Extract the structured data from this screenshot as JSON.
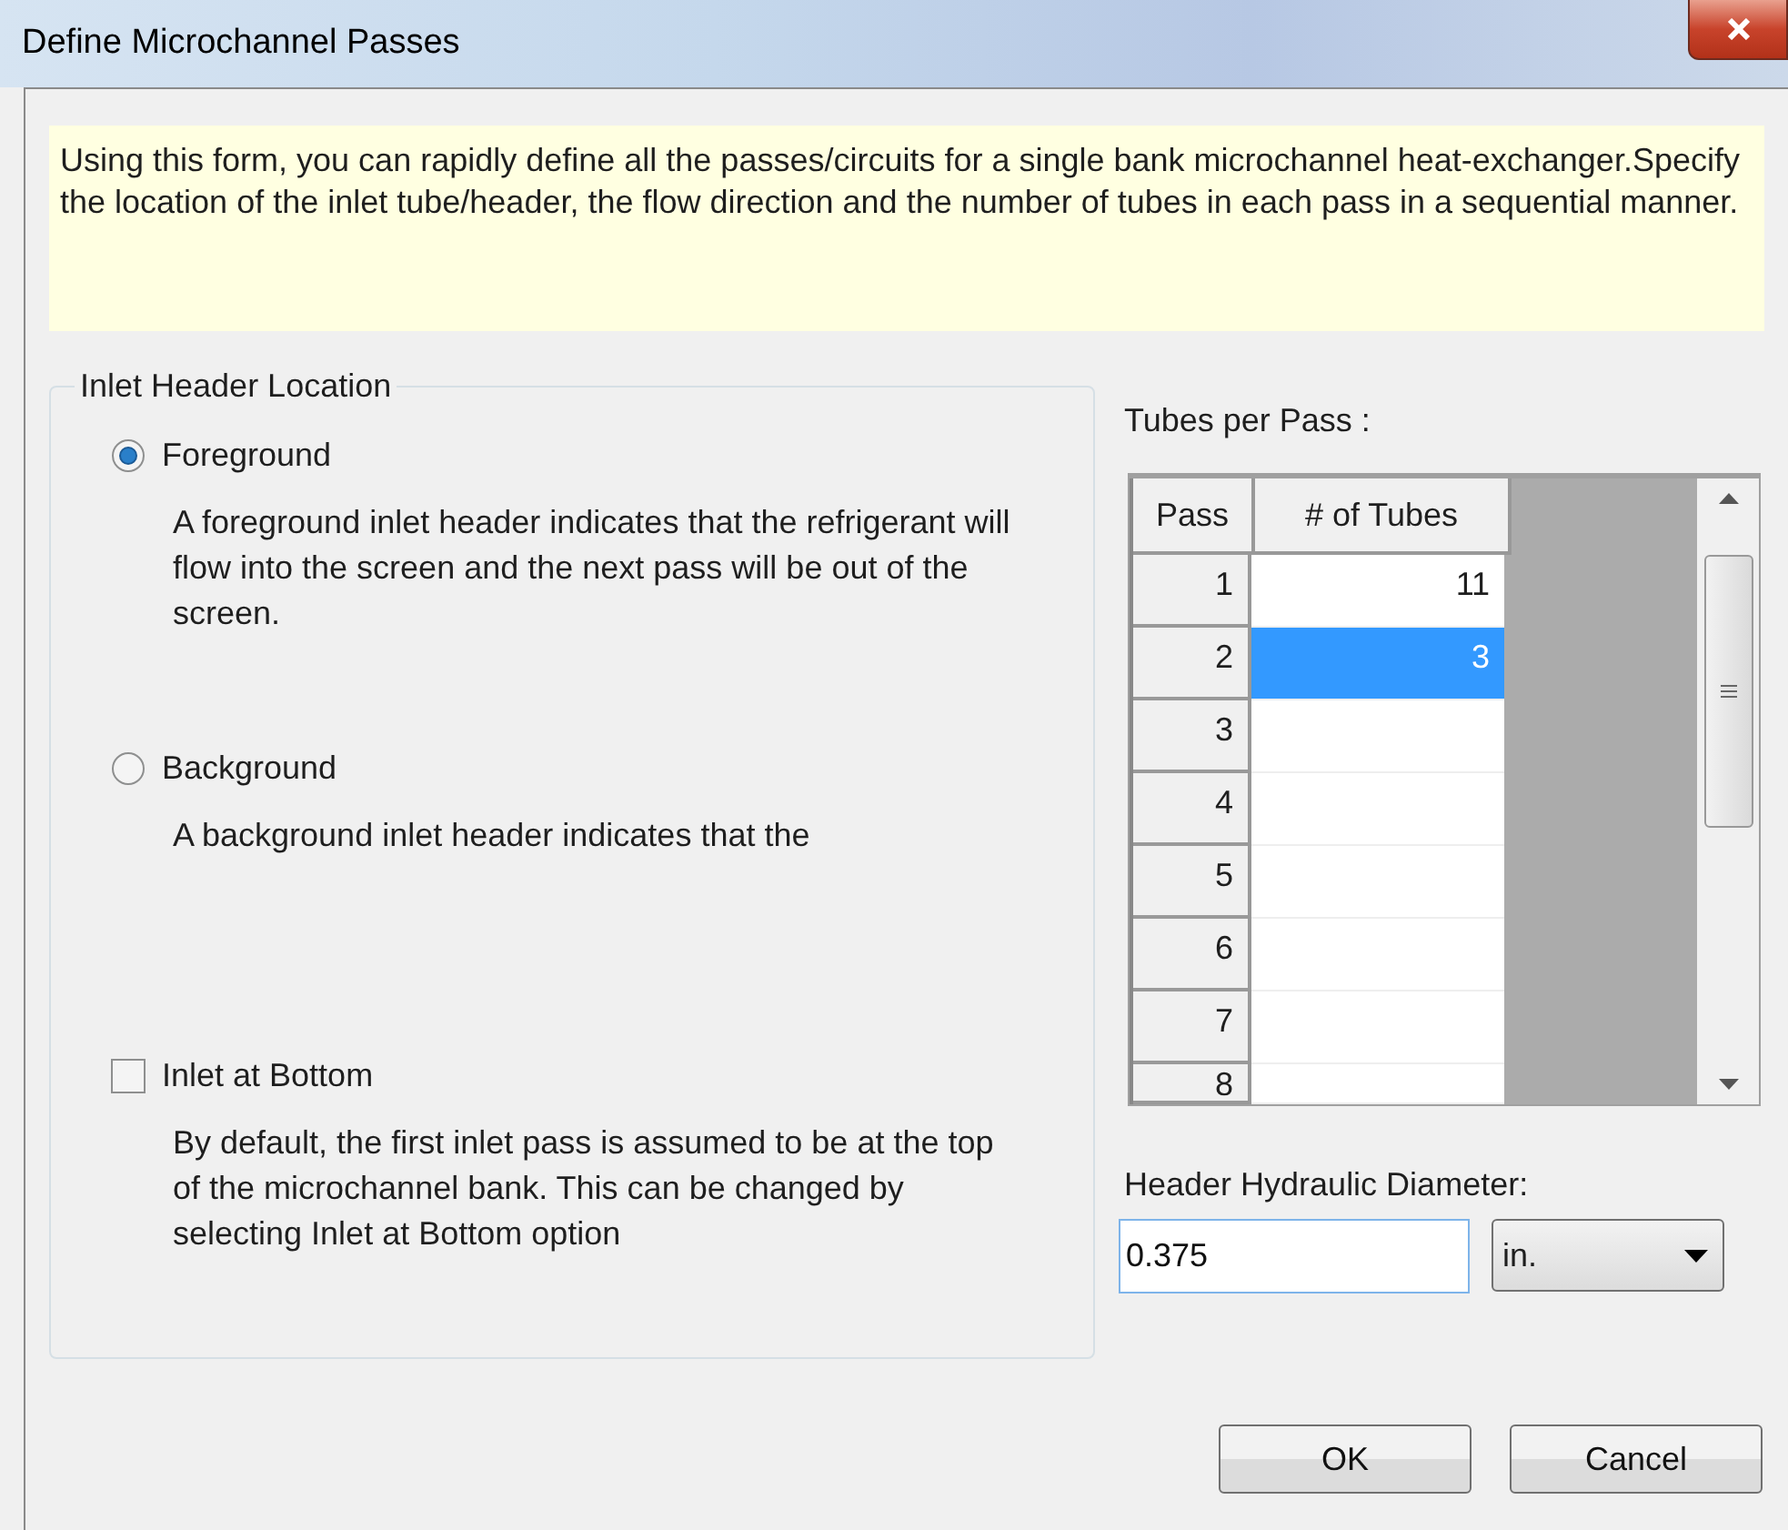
{
  "window": {
    "title": "Define Microchannel Passes"
  },
  "info": "Using this form, you can rapidly define all the passes/circuits for a single bank microchannel heat-exchanger.Specify the location of the inlet tube/header, the flow direction and the number of tubes in each pass in a sequential manner.",
  "inlet_header_location": {
    "title": "Inlet Header Location",
    "options": [
      {
        "kind": "radio",
        "label": "Foreground",
        "selected": true,
        "description": "A foreground inlet header indicates that the refrigerant will flow into the screen and the next pass will be out of the screen."
      },
      {
        "kind": "radio",
        "label": "Background",
        "selected": false,
        "description": "A background inlet header indicates that the"
      },
      {
        "kind": "checkbox",
        "label": "Inlet at Bottom",
        "checked": false,
        "description": "By default, the first inlet pass is assumed to be at the top of the microchannel bank. This can be changed by selecting Inlet at Bottom option"
      }
    ]
  },
  "tubes_per_pass": {
    "label": "Tubes per Pass :",
    "columns": [
      "Pass",
      "# of Tubes"
    ],
    "rows": [
      {
        "pass": "1",
        "tubes": "11",
        "selected": false
      },
      {
        "pass": "2",
        "tubes": "3",
        "selected": true
      },
      {
        "pass": "3",
        "selected": false
      },
      {
        "pass": "4",
        "selected": false
      },
      {
        "pass": "5",
        "selected": false
      },
      {
        "pass": "6",
        "selected": false
      },
      {
        "pass": "7",
        "selected": false
      },
      {
        "pass": "8",
        "selected": false
      }
    ]
  },
  "header_hydraulic_diameter": {
    "label": "Header Hydraulic Diameter:",
    "value": "0.375",
    "unit": "in."
  },
  "buttons": [
    "OK",
    "Cancel"
  ]
}
